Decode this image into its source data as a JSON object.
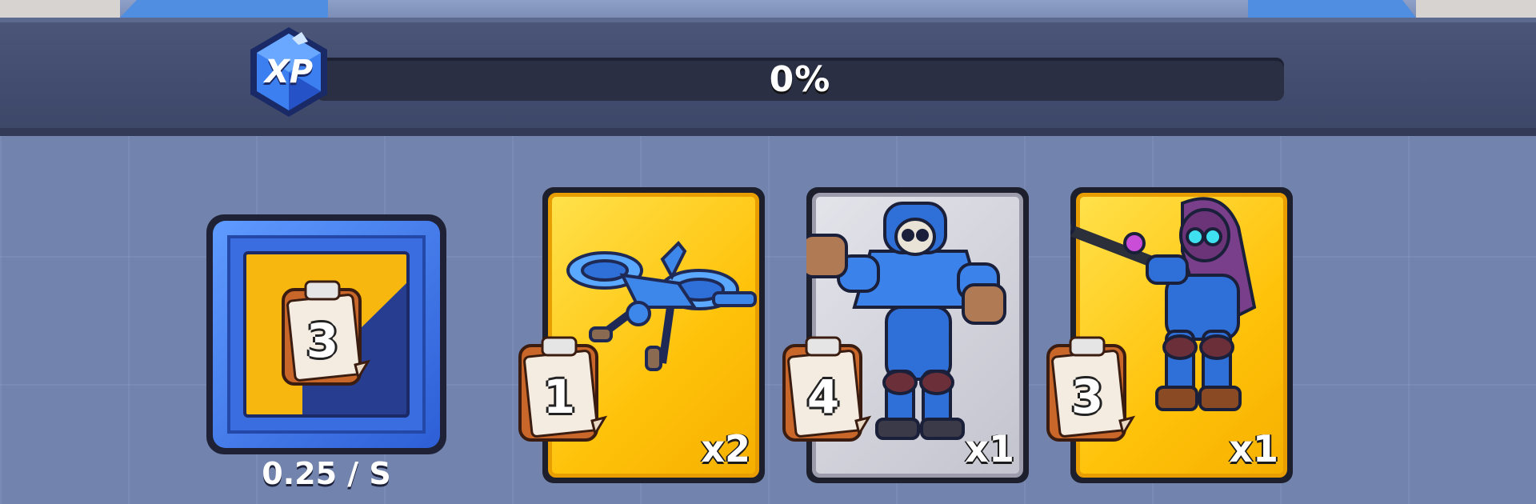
{
  "xp": {
    "badge_label": "XP",
    "progress_text": "0%",
    "progress": 0.0
  },
  "generator": {
    "cost": "3",
    "rate_text": "0.25 / S",
    "fill_fraction": 0.55
  },
  "cards": [
    {
      "unit_icon": "drone-icon",
      "cost": "1",
      "quantity": "x2",
      "color": "#ffc20a"
    },
    {
      "unit_icon": "armored-skull-robot-icon",
      "cost": "4",
      "quantity": "x1",
      "color": "#c8c8d2"
    },
    {
      "unit_icon": "hooded-sniper-icon",
      "cost": "3",
      "quantity": "x1",
      "color": "#ffc20a"
    }
  ],
  "colors": {
    "xp_badge": "#2f6fe0",
    "card_yellow": "#ffc20a",
    "card_gray": "#c8c8d2",
    "generator_blue": "#3a6ee0"
  }
}
